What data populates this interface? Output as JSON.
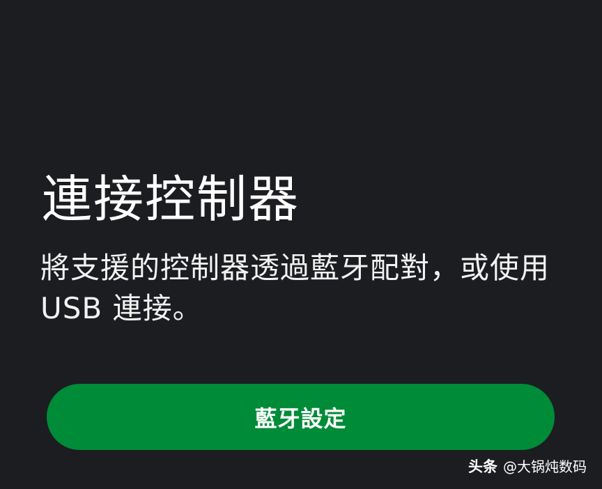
{
  "dialog": {
    "title": "連接控制器",
    "description": "將支援的控制器透過藍牙配對，或使用 USB 連接。",
    "primary_button_label": "藍牙設定"
  },
  "watermark": {
    "brand": "头条",
    "handle": "@大锅炖数码"
  },
  "colors": {
    "background": "#1c1d21",
    "button_green": "#008b38",
    "text": "#ffffff"
  }
}
